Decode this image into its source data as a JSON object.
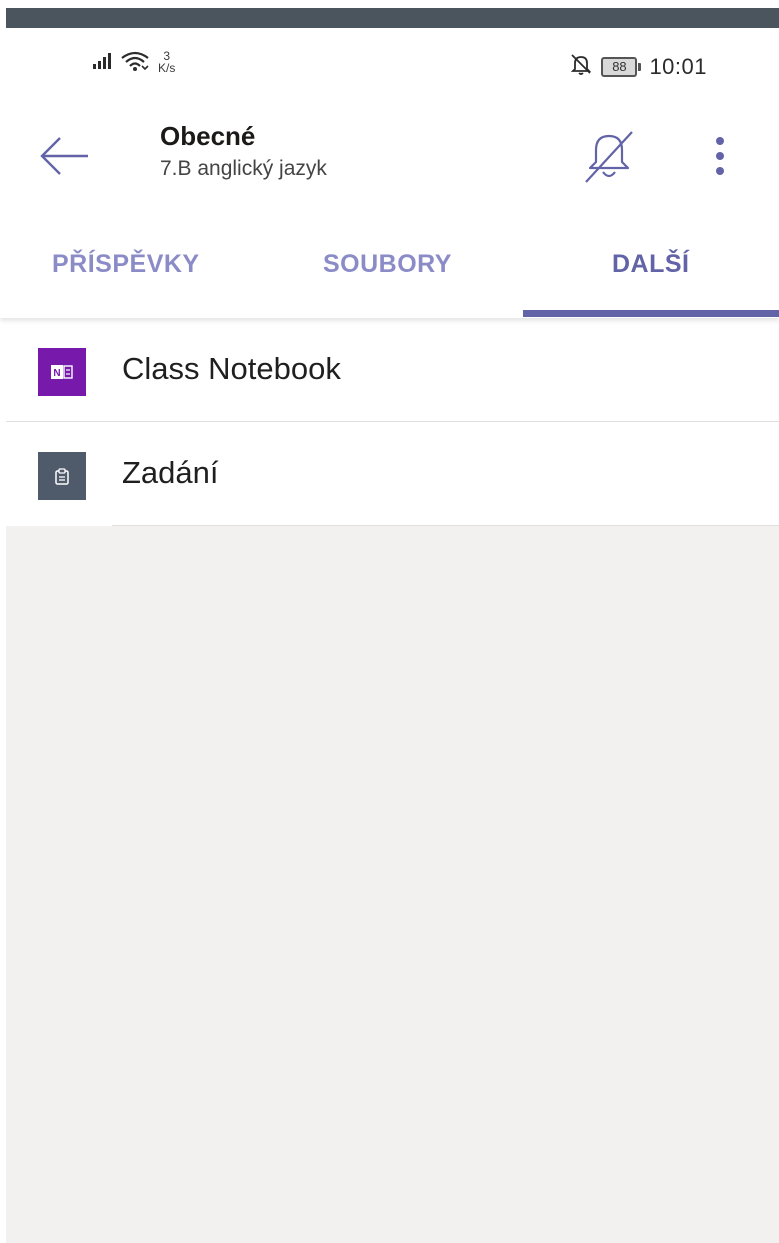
{
  "status_bar": {
    "signal_icon": "signal-bars-icon",
    "wifi_icon": "wifi-icon",
    "net_speed_value": "3",
    "net_speed_unit": "K/s",
    "bell_off_icon": "bell-off-icon",
    "battery_level": "88",
    "time": "10:01"
  },
  "header": {
    "back_icon": "arrow-left-icon",
    "title": "Obecné",
    "subtitle": "7.B anglický jazyk",
    "mute_icon": "bell-slash-icon",
    "more_icon": "more-vertical-icon"
  },
  "tabs": [
    {
      "label": "PŘÍSPĚVKY",
      "active": false
    },
    {
      "label": "SOUBORY",
      "active": false
    },
    {
      "label": "DALŠÍ",
      "active": true
    }
  ],
  "list": [
    {
      "label": "Class Notebook",
      "icon": "onenote-icon",
      "icon_color": "#7719aa"
    },
    {
      "label": "Zadání",
      "icon": "assignments-icon",
      "icon_color": "#4f5a6b"
    }
  ],
  "colors": {
    "accent": "#6264a7",
    "tab_inactive": "#8b8cc7",
    "empty_background": "#f2f1f0",
    "top_bar": "#4a555e"
  }
}
